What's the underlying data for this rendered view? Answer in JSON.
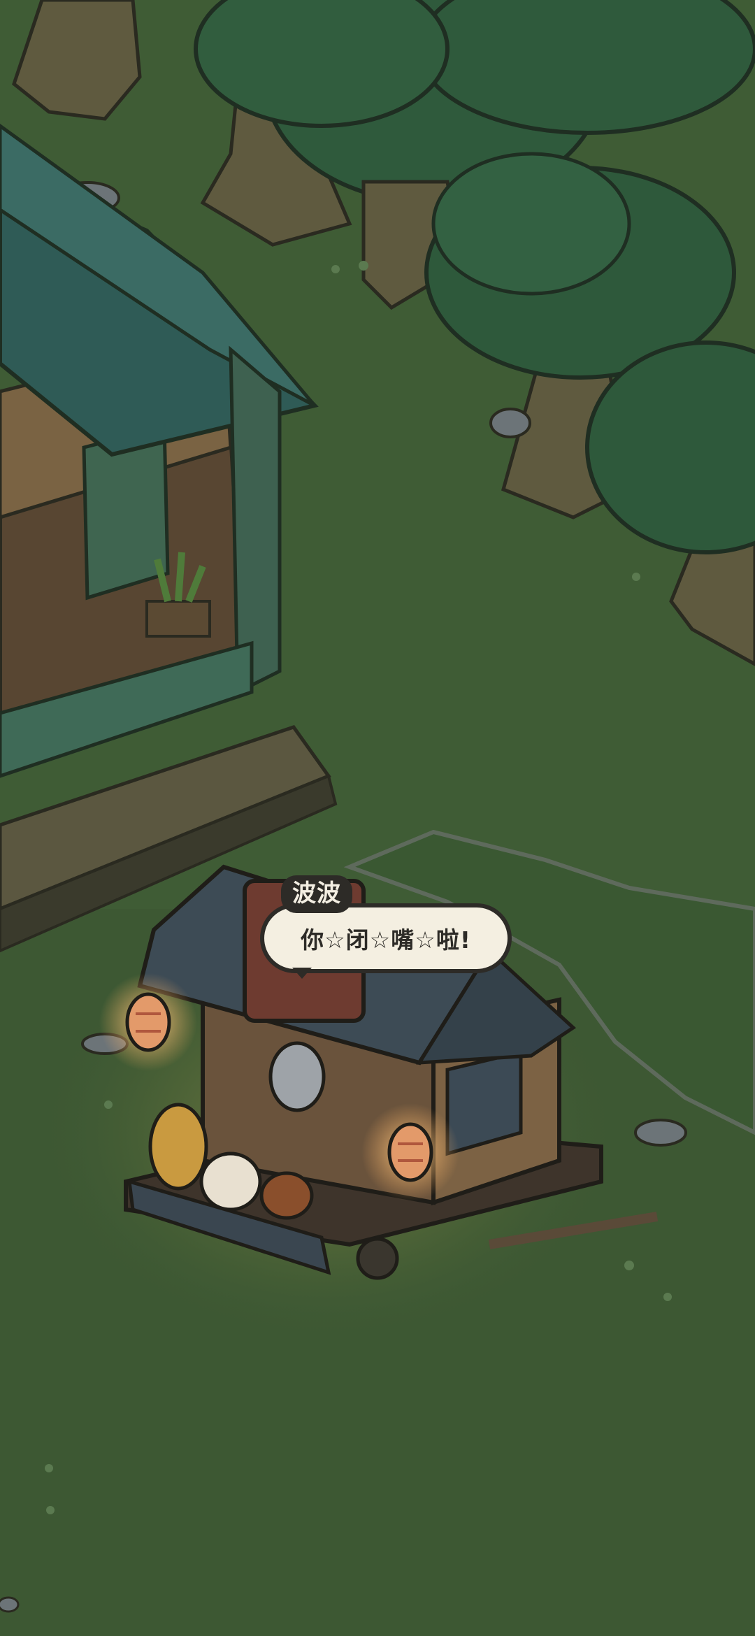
{
  "scene": {
    "background_color": "#3e5a34",
    "lantern_glow_color": "#f2b56a"
  },
  "dialogue": {
    "speaker": "波波",
    "text": "你☆闭☆嘴☆啦!"
  },
  "icons": {
    "tree": "tree-icon",
    "house": "house-icon",
    "lantern": "lantern-icon",
    "cart": "food-cart-icon"
  }
}
